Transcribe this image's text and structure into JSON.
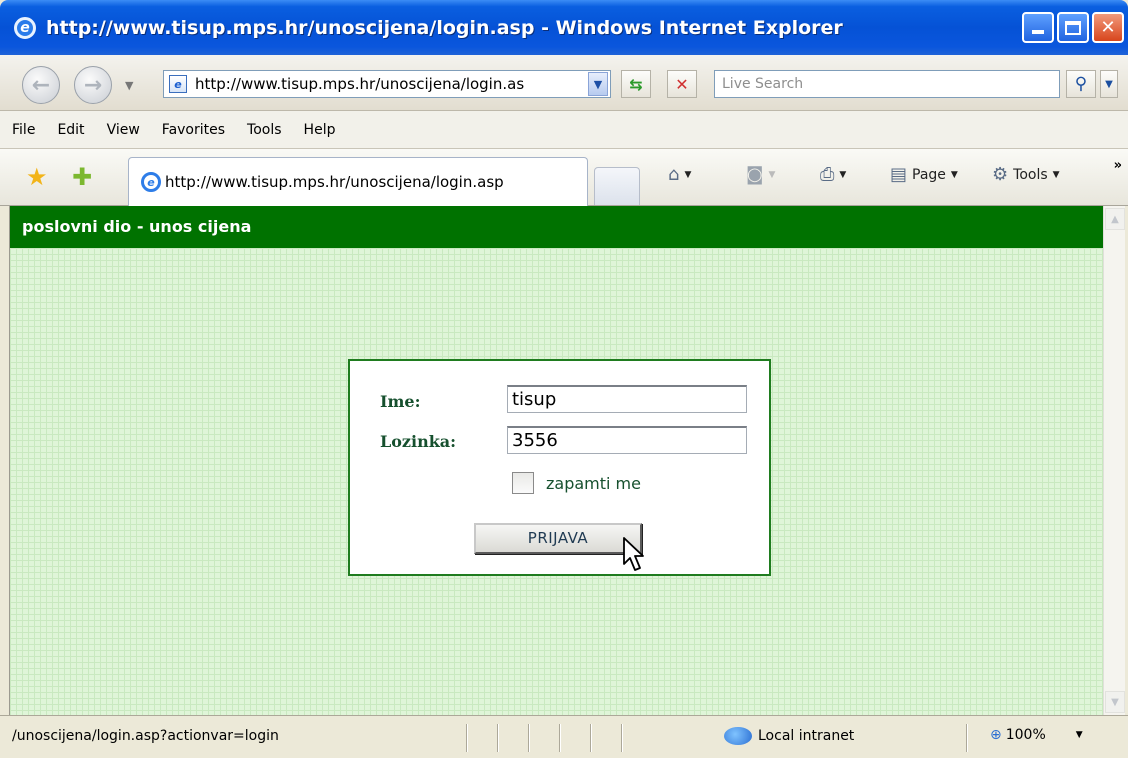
{
  "window": {
    "title": "http://www.tisup.mps.hr/unoscijena/login.asp - Windows Internet Explorer"
  },
  "address_bar": {
    "url": "http://www.tisup.mps.hr/unoscijena/login.as",
    "search_placeholder": "Live Search"
  },
  "menu": {
    "items": [
      "File",
      "Edit",
      "View",
      "Favorites",
      "Tools",
      "Help"
    ]
  },
  "tab": {
    "title": "http://www.tisup.mps.hr/unoscijena/login.asp"
  },
  "command_bar": {
    "page_label": "Page",
    "tools_label": "Tools",
    "overflow": "»"
  },
  "page": {
    "header": "poslovni dio - unos cijena",
    "login": {
      "username_label": "Ime:",
      "username_value": "tisup",
      "password_label": "Lozinka:",
      "password_value": "3556",
      "remember_label": "zapamti me",
      "remember_checked": false,
      "submit_label": "PRIJAVA"
    }
  },
  "status_bar": {
    "text": "/unoscijena/login.asp?actionvar=login",
    "zone": "Local intranet",
    "zoom": "100%"
  },
  "colors": {
    "header_green": "#007200",
    "label_green": "#16502e",
    "page_bg": "#dff5d8"
  }
}
